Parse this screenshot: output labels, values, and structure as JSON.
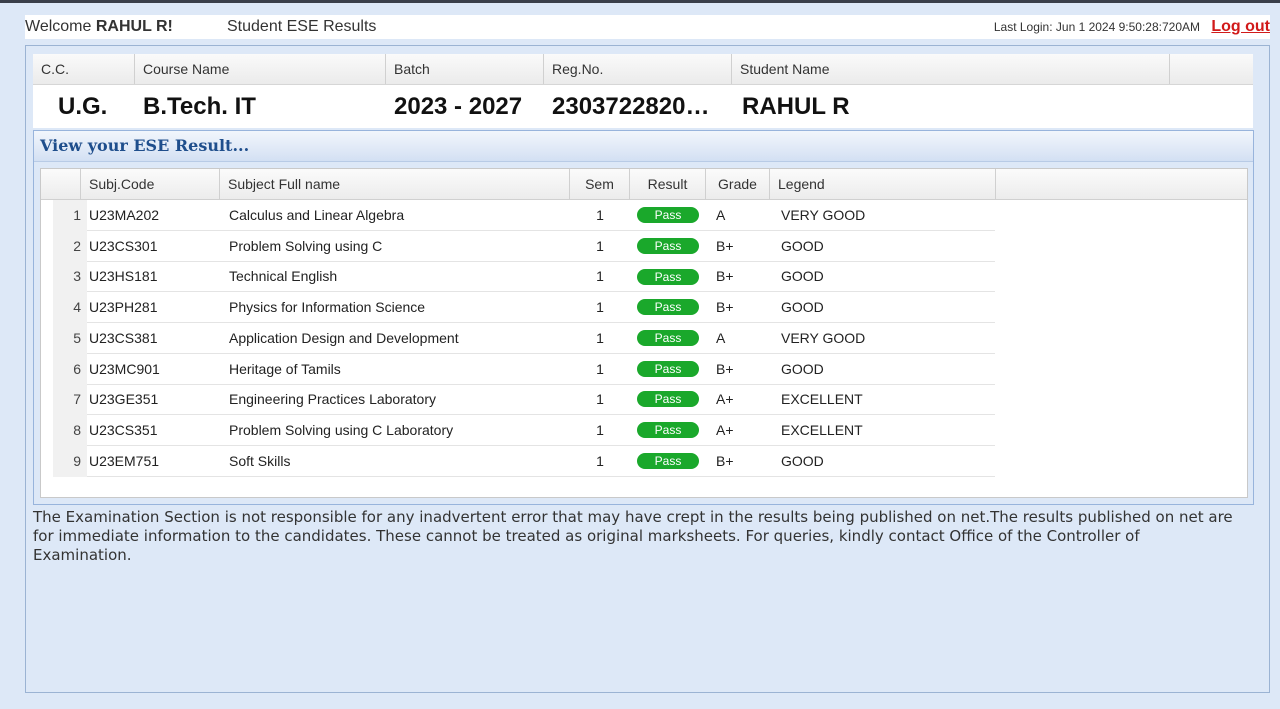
{
  "header": {
    "welcome_prefix": "Welcome ",
    "user": "RAHUL R!",
    "title": "Student ESE Results",
    "last_login": "Last Login: Jun 1 2024 9:50:28:720AM",
    "logout": "Log out"
  },
  "info": {
    "columns": [
      "C.C.",
      "Course Name",
      "Batch",
      "Reg.No.",
      "Student Name"
    ],
    "values": [
      "U.G.",
      "B.Tech. IT",
      "2023 - 2027",
      "2303722820…",
      "RAHUL R"
    ]
  },
  "result_panel": {
    "title": "View your ESE Result..."
  },
  "grid": {
    "columns": [
      "",
      "Subj.Code",
      "Subject Full name",
      "Sem",
      "Result",
      "Grade",
      "Legend"
    ],
    "rows": [
      {
        "n": "1",
        "code": "U23MA202",
        "name": "Calculus and Linear Algebra",
        "sem": "1",
        "result": "Pass",
        "grade": "A",
        "legend": "VERY GOOD"
      },
      {
        "n": "2",
        "code": "U23CS301",
        "name": "Problem Solving using C",
        "sem": "1",
        "result": "Pass",
        "grade": "B+",
        "legend": "GOOD"
      },
      {
        "n": "3",
        "code": "U23HS181",
        "name": "Technical English",
        "sem": "1",
        "result": "Pass",
        "grade": "B+",
        "legend": "GOOD"
      },
      {
        "n": "4",
        "code": "U23PH281",
        "name": "Physics for Information Science",
        "sem": "1",
        "result": "Pass",
        "grade": "B+",
        "legend": "GOOD"
      },
      {
        "n": "5",
        "code": "U23CS381",
        "name": "Application Design and Development",
        "sem": "1",
        "result": "Pass",
        "grade": "A",
        "legend": "VERY GOOD"
      },
      {
        "n": "6",
        "code": "U23MC901",
        "name": "Heritage of Tamils",
        "sem": "1",
        "result": "Pass",
        "grade": "B+",
        "legend": "GOOD"
      },
      {
        "n": "7",
        "code": "U23GE351",
        "name": "Engineering Practices Laboratory",
        "sem": "1",
        "result": "Pass",
        "grade": "A+",
        "legend": "EXCELLENT"
      },
      {
        "n": "8",
        "code": "U23CS351",
        "name": "Problem Solving using C Laboratory",
        "sem": "1",
        "result": "Pass",
        "grade": "A+",
        "legend": "EXCELLENT"
      },
      {
        "n": "9",
        "code": "U23EM751",
        "name": "Soft Skills",
        "sem": "1",
        "result": "Pass",
        "grade": "B+",
        "legend": "GOOD"
      }
    ]
  },
  "disclaimer": "The Examination Section is not responsible for any inadvertent error that may have crept in the results being published on net.The results published on net are for immediate information to the candidates. These cannot be treated as original marksheets. For queries, kindly contact Office of the Controller of Examination.",
  "colors": {
    "pass": "#1aa82b",
    "logout": "#d11a1a",
    "panel_title": "#1f4e8c",
    "background": "#dde8f7"
  }
}
